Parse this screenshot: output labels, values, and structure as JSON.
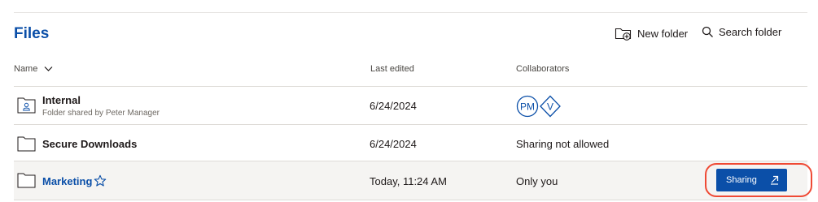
{
  "page": {
    "title": "Files"
  },
  "toolbar": {
    "new_folder_label": "New folder",
    "search_folder_label": "Search folder"
  },
  "table": {
    "columns": {
      "name": "Name",
      "last_edited": "Last edited",
      "collaborators": "Collaborators"
    },
    "rows": [
      {
        "name": "Internal",
        "subtitle": "Folder shared by Peter Manager",
        "last_edited": "6/24/2024",
        "collaborators": {
          "avatars": [
            "PM",
            "V"
          ]
        },
        "icon": "shared-folder-icon"
      },
      {
        "name": "Secure Downloads",
        "last_edited": "6/24/2024",
        "collaborators_text": "Sharing not allowed",
        "icon": "folder-icon"
      },
      {
        "name": "Marketing",
        "last_edited": "Today, 11:24 AM",
        "collaborators_text": "Only you",
        "icon": "folder-icon",
        "starred": false,
        "action_label": "Sharing"
      }
    ]
  },
  "colors": {
    "accent": "#0b4fa8",
    "highlight_ring": "#ef4a35"
  }
}
